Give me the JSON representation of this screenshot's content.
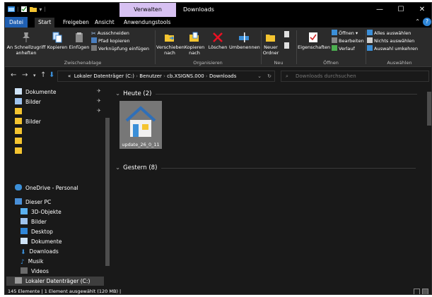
{
  "window": {
    "title": "Downloads",
    "context_tab": "Verwalten",
    "controls": {
      "minimize": "—",
      "maximize": "☐",
      "close": "✕"
    }
  },
  "tabs": {
    "file": "Datei",
    "items": [
      "Start",
      "Freigeben",
      "Ansicht",
      "Anwendungstools"
    ],
    "active": "Start"
  },
  "ribbon": {
    "clipboard": {
      "pin": "An Schnellzugriff anheften",
      "copy": "Kopieren",
      "paste": "Einfügen",
      "cut": "Ausschneiden",
      "copy_path": "Pfad kopieren",
      "paste_shortcut": "Verknüpfung einfügen",
      "label": "Zwischenablage"
    },
    "organize": {
      "move": "Verschieben nach",
      "copy_to": "Kopieren nach",
      "delete": "Löschen",
      "rename": "Umbenennen",
      "label": "Organisieren"
    },
    "new": {
      "folder": "Neuer Ordner",
      "label": "Neu"
    },
    "open": {
      "properties": "Eigenschaften",
      "open": "Öffnen",
      "edit": "Bearbeiten",
      "history": "Verlauf",
      "label": "Öffnen"
    },
    "select": {
      "all": "Alles auswählen",
      "none": "Nichts auswählen",
      "invert": "Auswahl umkehren",
      "label": "Auswählen"
    }
  },
  "address": {
    "prefix": "«",
    "crumbs": [
      "Lokaler Datenträger (C:)",
      "Benutzer",
      "cb.XSIGNS.000",
      "Downloads"
    ],
    "search_placeholder": "Downloads durchsuchen"
  },
  "nav": {
    "quick": [
      {
        "label": "Dokumente",
        "pinned": true
      },
      {
        "label": "Bilder",
        "pinned": true
      },
      {
        "label": "",
        "pinned": true
      },
      {
        "label": "Bilder",
        "pinned": false
      },
      {
        "label": "",
        "pinned": false
      },
      {
        "label": "",
        "pinned": false
      },
      {
        "label": "",
        "pinned": false
      }
    ],
    "onedrive": "OneDrive - Personal",
    "this_pc": "Dieser PC",
    "pc_items": [
      "3D-Objekte",
      "Bilder",
      "Desktop",
      "Dokumente",
      "Downloads",
      "Musik",
      "Videos",
      "Lokaler Datenträger (C:)"
    ]
  },
  "content": {
    "group_today": "Heute (2)",
    "group_yesterday": "Gestern (8)",
    "file_name": "update_26_0_11"
  },
  "status": {
    "text": "145 Elemente  |  1 Element ausgewählt (120 MB)  |"
  },
  "colors": {
    "accent": "#1f5fb2",
    "context_tab": "#d7c1f2",
    "background": "#191919",
    "ribbon": "#2b2b2b"
  }
}
